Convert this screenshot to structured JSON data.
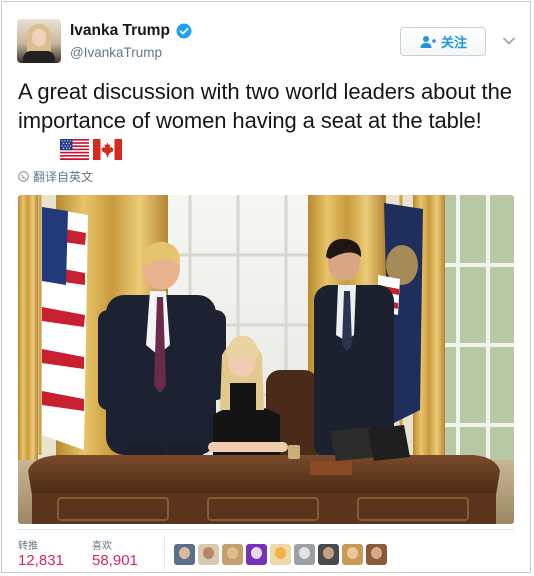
{
  "user": {
    "display_name": "Ivanka Trump",
    "handle": "@IvankaTrump",
    "verified": true,
    "avatar_icon": "profile-photo"
  },
  "actions": {
    "follow_label": "关注",
    "follow_icon": "add-user-icon",
    "more_icon": "chevron-down-icon"
  },
  "tweet": {
    "text": "A great discussion with two world leaders about the importance of women having a seat at the table!",
    "emoji": [
      "us-flag",
      "canada-flag"
    ],
    "translate_label": "翻译自英文",
    "translate_icon": "globe-icon"
  },
  "media": {
    "type": "photo",
    "subject": "oval-office-photo"
  },
  "stats": {
    "retweets_label": "转推",
    "retweets_value": "12,831",
    "likes_label": "喜欢",
    "likes_value": "58,901"
  },
  "likers": {
    "count_shown": 9,
    "tile_colors": [
      "#5a6f8a",
      "#d8c9b0",
      "#c69f6e",
      "#7a2fb8",
      "#f0d9a8",
      "#9aa0a6",
      "#4a4a4a",
      "#c89a55",
      "#8a5a3a"
    ],
    "face_colors": [
      "#f1c7a4",
      "#b07a5a",
      "#e8c09a",
      "#f7f7f7",
      "#f4a93b",
      "#eeeeee",
      "#d9b08a",
      "#f0cfa8",
      "#e4b896"
    ]
  },
  "colors": {
    "accent": "#1b95e0",
    "like_red": "#e0245e",
    "muted": "#657786"
  }
}
